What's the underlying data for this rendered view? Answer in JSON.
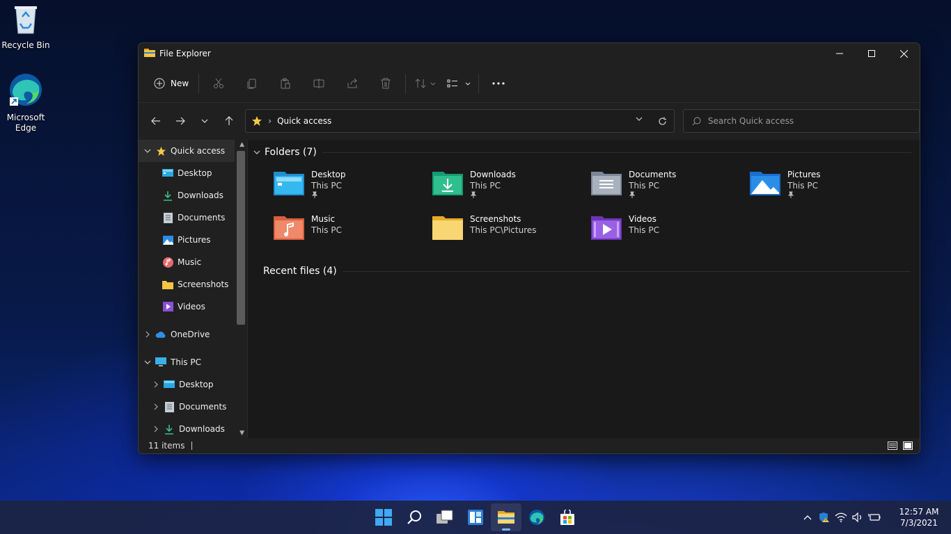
{
  "desktop": {
    "icons": [
      {
        "label": "Recycle Bin"
      },
      {
        "label": "Microsoft Edge"
      }
    ]
  },
  "window": {
    "title": "File Explorer",
    "controls": {
      "minimize": "minimize",
      "maximize": "maximize",
      "close": "close"
    }
  },
  "toolbar": {
    "new_label": "New",
    "icons": [
      "cut-icon",
      "copy-icon",
      "paste-icon",
      "rename-icon",
      "share-icon",
      "delete-icon",
      "sort-icon",
      "view-icon",
      "more-icon"
    ]
  },
  "address": {
    "location": "Quick access",
    "search_placeholder": "Search Quick access"
  },
  "sidebar": {
    "items": [
      {
        "label": "Quick access",
        "icon": "star-icon",
        "expanded": true
      },
      {
        "label": "Desktop",
        "icon": "desktop-icon",
        "pinned": true
      },
      {
        "label": "Downloads",
        "icon": "downloads-icon",
        "pinned": true
      },
      {
        "label": "Documents",
        "icon": "documents-icon",
        "pinned": true
      },
      {
        "label": "Pictures",
        "icon": "pictures-icon",
        "pinned": true
      },
      {
        "label": "Music",
        "icon": "music-icon"
      },
      {
        "label": "Screenshots",
        "icon": "folder-icon"
      },
      {
        "label": "Videos",
        "icon": "videos-icon"
      },
      {
        "label": "OneDrive",
        "icon": "onedrive-icon",
        "expanded": false
      },
      {
        "label": "This PC",
        "icon": "pc-icon",
        "expanded": true
      },
      {
        "label": "Desktop",
        "icon": "desktop-icon"
      },
      {
        "label": "Documents",
        "icon": "documents-icon"
      },
      {
        "label": "Downloads",
        "icon": "downloads-icon"
      }
    ]
  },
  "content": {
    "folders_header": "Folders (7)",
    "recent_header": "Recent files (4)",
    "folders": [
      {
        "name": "Desktop",
        "location": "This PC",
        "pinned": true
      },
      {
        "name": "Downloads",
        "location": "This PC",
        "pinned": true
      },
      {
        "name": "Documents",
        "location": "This PC",
        "pinned": true
      },
      {
        "name": "Pictures",
        "location": "This PC",
        "pinned": true
      },
      {
        "name": "Music",
        "location": "This PC",
        "pinned": false
      },
      {
        "name": "Screenshots",
        "location": "This PC\\Pictures",
        "pinned": false
      },
      {
        "name": "Videos",
        "location": "This PC",
        "pinned": false
      }
    ]
  },
  "statusbar": {
    "items_count": "11 items"
  },
  "taskbar": {
    "apps": [
      "start-icon",
      "search-icon",
      "task-view-icon",
      "widgets-icon",
      "file-explorer-icon",
      "edge-icon",
      "store-icon"
    ],
    "clock_time": "12:57 AM",
    "clock_date": "7/3/2021"
  },
  "colors": {
    "window_bg": "#202020",
    "content_bg": "#191919",
    "accent": "#7fb7ff",
    "folder_yellow": "#f4c542"
  }
}
